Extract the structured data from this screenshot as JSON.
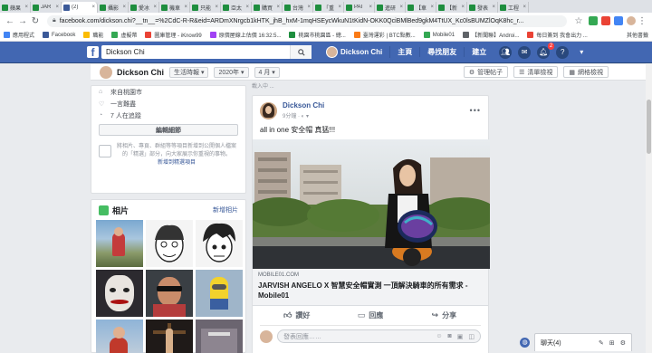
{
  "browser": {
    "tabs": [
      {
        "label": "蘋果",
        "fav": "g",
        "active": false
      },
      {
        "label": "JAR",
        "fav": "g",
        "active": false
      },
      {
        "label": "(2)",
        "fav": "f",
        "active": true
      },
      {
        "label": "攝影",
        "fav": "g",
        "active": false
      },
      {
        "label": "愛冰",
        "fav": "g",
        "active": false
      },
      {
        "label": "機車",
        "fav": "g",
        "active": false
      },
      {
        "label": "只能",
        "fav": "g",
        "active": false
      },
      {
        "label": "亞太",
        "fav": "g",
        "active": false
      },
      {
        "label": "購買",
        "fav": "g",
        "active": false
      },
      {
        "label": "台灣",
        "fav": "g",
        "active": false
      },
      {
        "label": "「重",
        "fav": "g",
        "active": false
      },
      {
        "label": "PAI",
        "fav": "g",
        "active": false
      },
      {
        "label": "進研",
        "fav": "g",
        "active": false
      },
      {
        "label": "【車",
        "fav": "g",
        "active": false
      },
      {
        "label": "【新",
        "fav": "g",
        "active": false
      },
      {
        "label": "發表",
        "fav": "g",
        "active": false
      },
      {
        "label": "工程",
        "fav": "g",
        "active": false
      }
    ],
    "url": "facebook.com/dickson.chi?__tn__=%2CdC-R-R&eid=ARDmXNrgcb1kHTK_jhB_hxM-1mqHSEycWkuN1tKidN-OKK0QciBMlBed9gkM4TtUX_Kc0lsBUMZlOqK8hc_r...",
    "bookmarks": [
      {
        "label": "應用程式",
        "color": "#4285f4"
      },
      {
        "label": "Facebook",
        "color": "#3b5998"
      },
      {
        "label": "職能",
        "color": "#fbbc04"
      },
      {
        "label": "虛擬幣",
        "color": "#34a853"
      },
      {
        "label": "圖庫管理 - iKnow99",
        "color": "#ea4335"
      },
      {
        "label": "原價屋線上估價 16:32:5...",
        "color": "#a142f4"
      },
      {
        "label": "桃園市桃園區 - 總...",
        "color": "#1e8e3e"
      },
      {
        "label": "臺灣運彩 | BTC點數...",
        "color": "#fa7b17"
      },
      {
        "label": "Mobile01",
        "color": "#34a853"
      },
      {
        "label": "【新聞聯】Androi...",
        "color": "#5f6368"
      },
      {
        "label": "每日簽到 我會出力 ...",
        "color": "#ea4335"
      }
    ],
    "other_bookmarks": "其他書籤"
  },
  "fb_header": {
    "logo": "f",
    "search_value": "Dickson Chi",
    "user_name": "Dickson Chi",
    "nav": [
      "主頁",
      "尋找朋友",
      "建立"
    ],
    "notif_badge": "2"
  },
  "subbar": {
    "name": "Dickson Chi",
    "timeline_dd": "生活時報 ▾",
    "year_dd": "2020年 ▾",
    "month_dd": "4 月 ▾",
    "btn_manage": "管理帖子",
    "btn_list": "清單檢視",
    "btn_grid": "網格檢視"
  },
  "intro": {
    "rows": [
      {
        "icon": "home-icon",
        "glyph": "⌂",
        "text": "來自桃園市"
      },
      {
        "icon": "heart-icon",
        "glyph": "♡",
        "text": "一言難盡"
      },
      {
        "icon": "clock-icon",
        "glyph": "◔",
        "text": "7 人在追蹤"
      }
    ],
    "edit_label": "編輯細節",
    "featured_text": "將相片、專頁、群組等等項目新增到公開個人檔案的「精選」部分，向大家展示你重視的事物。",
    "featured_link": "新增到精選項目"
  },
  "photos": {
    "title": "相片",
    "more": "新增相片"
  },
  "post": {
    "top_line": "載入中 ...",
    "author": "Dickson Chi",
    "time": "9分鐘 · ◐ ▾",
    "text": "all in one 安全帽 真猛!!!",
    "link_domain": "MOBILE01.COM",
    "link_title": "JARVISH ANGELO X 智慧安全帽實測 一頂解決騎車的所有需求 - Mobile01",
    "like": "讚好",
    "comment": "回應",
    "share": "分享",
    "comment_placeholder": "發表回應……"
  },
  "chat": {
    "label": "聊天(4)"
  }
}
